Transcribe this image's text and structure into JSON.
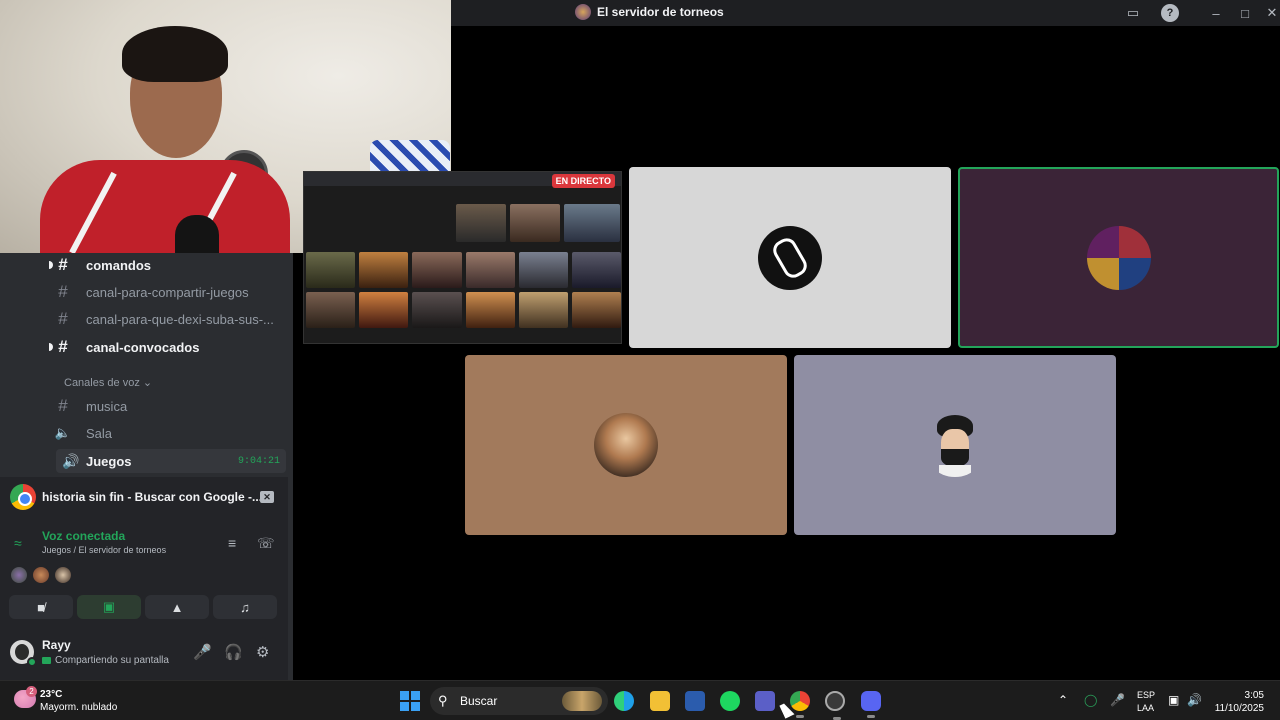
{
  "window": {
    "title": "El servidor de torneos"
  },
  "channels": [
    {
      "label": "comandos",
      "bold": true
    },
    {
      "label": "canal-para-compartir-juegos",
      "bold": false
    },
    {
      "label": "canal-para-que-dexi-suba-sus-...",
      "bold": false
    },
    {
      "label": "canal-convocados",
      "bold": true
    }
  ],
  "voice_category": {
    "label": "Canales de voz ⌄"
  },
  "voice_channels": [
    {
      "label": "musica",
      "icon": "hash-icon"
    },
    {
      "label": "Sala",
      "icon": "speaker-icon"
    },
    {
      "label": "Juegos",
      "icon": "speaker-icon",
      "timer": "9:04:21",
      "active": true
    }
  ],
  "stream_share": {
    "label": "historia sin fin - Buscar con Google -..."
  },
  "voice_panel": {
    "status": "Voz conectada",
    "location": "Juegos / El servidor de torneos"
  },
  "user": {
    "name": "Rayy",
    "status": "Compartiendo su pantalla"
  },
  "stream_preview": {
    "live_badge": "EN DIRECTO"
  },
  "taskbar": {
    "temperature": "23°C",
    "condition": "Mayorm. nublado",
    "weather_badge": "2",
    "search_placeholder": "Buscar",
    "language": "ESP",
    "layout": "LAA",
    "time": "3:05",
    "date": "11/10/2025"
  },
  "colors": {
    "accent_green": "#23a55a",
    "sidebar_bg": "#2b2d31",
    "panel_bg": "#232428",
    "live_red": "#da373c"
  }
}
